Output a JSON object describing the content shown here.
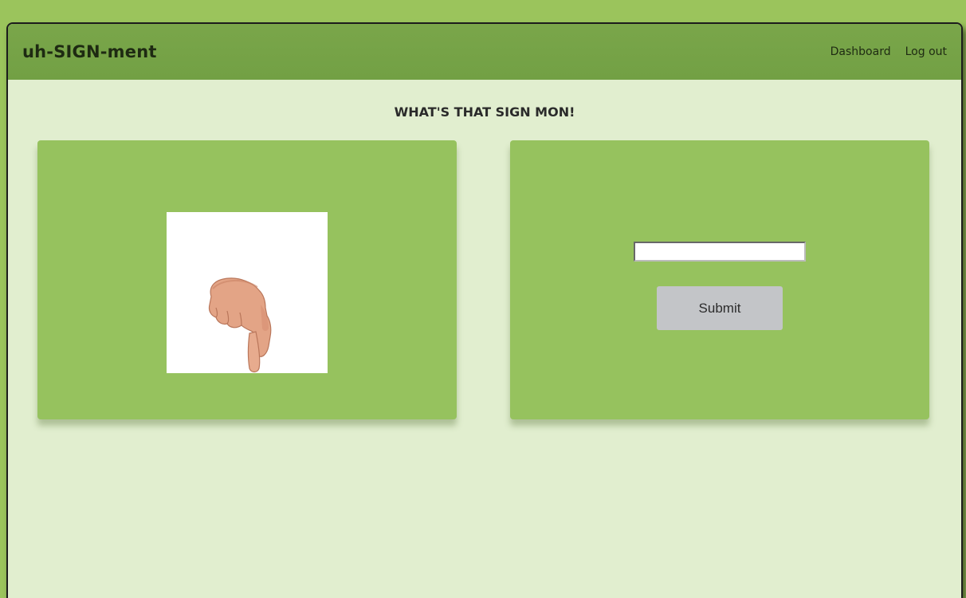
{
  "navbar": {
    "brand": "uh-SIGN-ment",
    "links": [
      "Dashboard",
      "Log out"
    ]
  },
  "main": {
    "heading": "WHAT'S THAT SIGN MON!",
    "sign_image": {
      "icon": "hand-pointing-down-sign",
      "alt": "ASL hand sign"
    },
    "answer_input": {
      "value": "",
      "placeholder": ""
    },
    "submit_label": "Submit"
  },
  "colors": {
    "background": "#9bc45c",
    "navbar": "#76a347",
    "page": "#e1eecf",
    "card": "#96c25e",
    "button": "#c3c5c8"
  }
}
